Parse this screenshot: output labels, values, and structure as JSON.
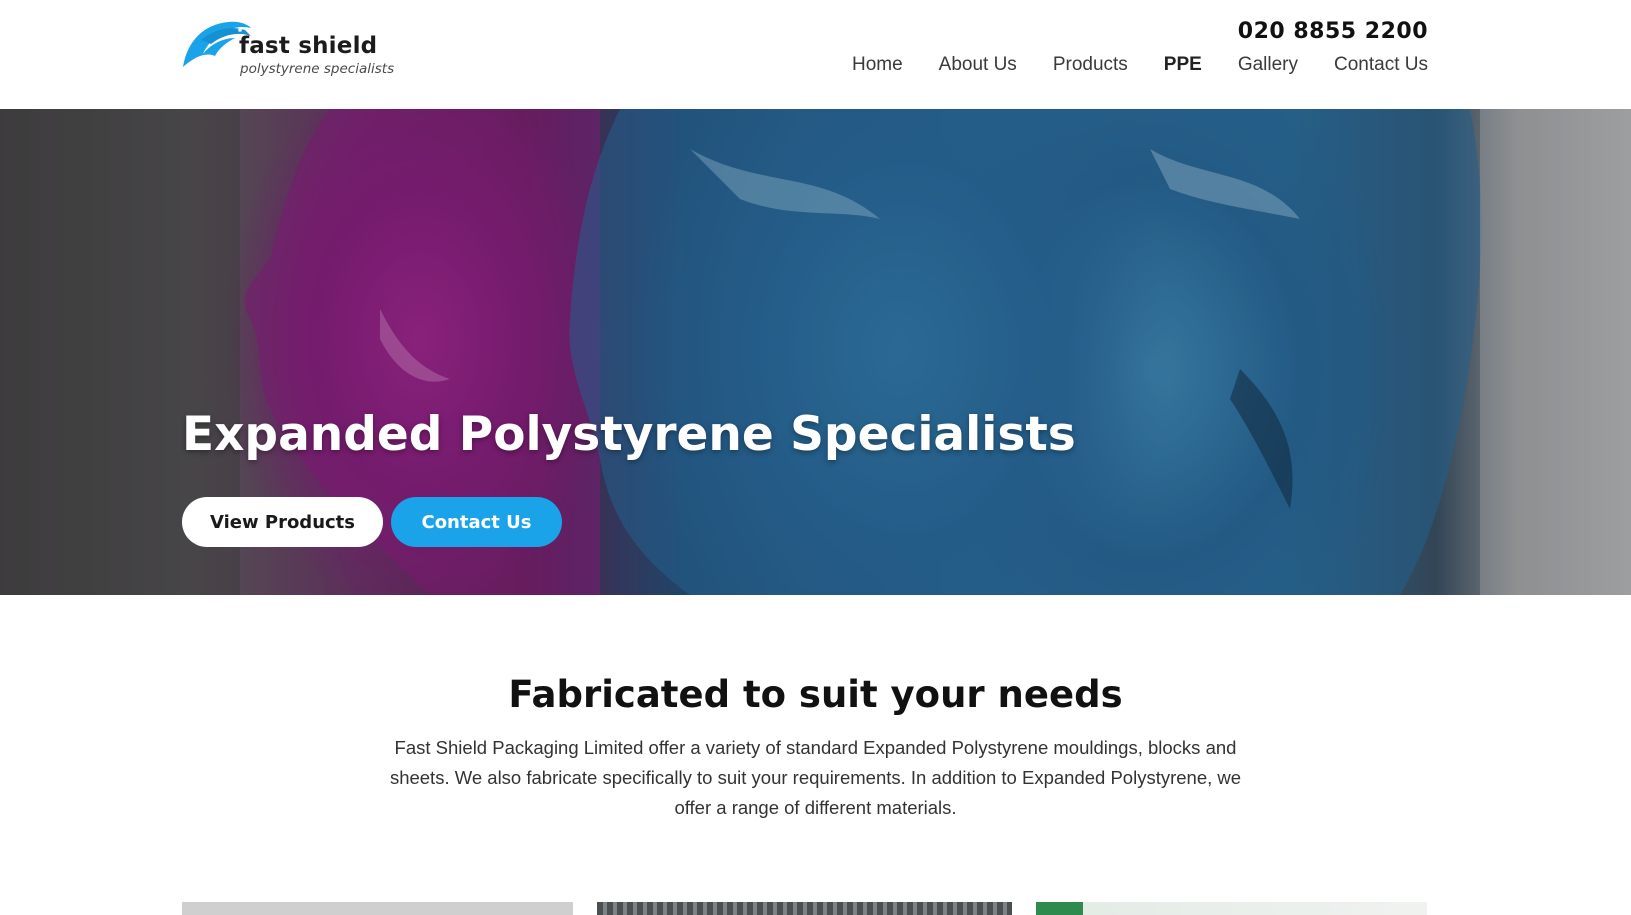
{
  "header": {
    "logo": {
      "name": "fast shield",
      "tagline": "polystyrene specialists",
      "icon": "dolphin-logo-icon",
      "color": "#1aa3e8"
    },
    "phone": "020 8855 2200",
    "nav": [
      {
        "label": "Home",
        "active": false
      },
      {
        "label": "About Us",
        "active": false
      },
      {
        "label": "Products",
        "active": false
      },
      {
        "label": "PPE",
        "active": true
      },
      {
        "label": "Gallery",
        "active": false
      },
      {
        "label": "Contact Us",
        "active": false
      }
    ]
  },
  "hero": {
    "title": "Expanded Polystyrene Specialists",
    "buttons": {
      "view_products": "View Products",
      "contact_us": "Contact Us"
    },
    "accent_color": "#1aa3e8"
  },
  "intro": {
    "title": "Fabricated to suit your needs",
    "body": "Fast Shield Packaging Limited offer a variety of standard Expanded Polystyrene mouldings, blocks and sheets. We also fabricate specifically to suit your requirements. In addition to Expanded Polystyrene, we offer a range of different materials."
  }
}
